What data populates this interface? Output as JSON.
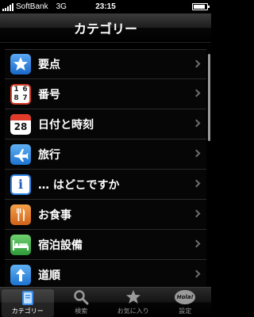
{
  "status": {
    "carrier": "SoftBank",
    "network": "3G",
    "time": "23:15",
    "signal_bars": 5,
    "battery_level": 0.75
  },
  "navbar": {
    "title": "カテゴリー"
  },
  "categories": [
    {
      "label": "要点",
      "icon": "star-icon",
      "icon_color": "#1f7fe0"
    },
    {
      "label": "番号",
      "icon": "numbers-icon",
      "icon_color": "#d03a25",
      "icon_text": "1 6 8 7"
    },
    {
      "label": "日付と時刻",
      "icon": "calendar-icon",
      "icon_color": "#e03a28",
      "icon_text": "28"
    },
    {
      "label": "旅行",
      "icon": "airplane-icon",
      "icon_color": "#2a8fe6"
    },
    {
      "label": "… はどこですか",
      "icon": "info-icon",
      "icon_color": "#2f86e8",
      "icon_text": "i"
    },
    {
      "label": "お食事",
      "icon": "cutlery-icon",
      "icon_color": "#e07a2a"
    },
    {
      "label": "宿泊設備",
      "icon": "bed-icon",
      "icon_color": "#3fae4a"
    },
    {
      "label": "道順",
      "icon": "directions-icon",
      "icon_color": "#2a8fe6"
    }
  ],
  "tabs": [
    {
      "label": "カテゴリー",
      "icon": "book-icon",
      "active": true
    },
    {
      "label": "検索",
      "icon": "search-icon",
      "active": false
    },
    {
      "label": "お気に入り",
      "icon": "star-icon",
      "active": false
    },
    {
      "label": "設定",
      "icon": "hola-icon",
      "active": false,
      "icon_text": "Hola!"
    }
  ]
}
